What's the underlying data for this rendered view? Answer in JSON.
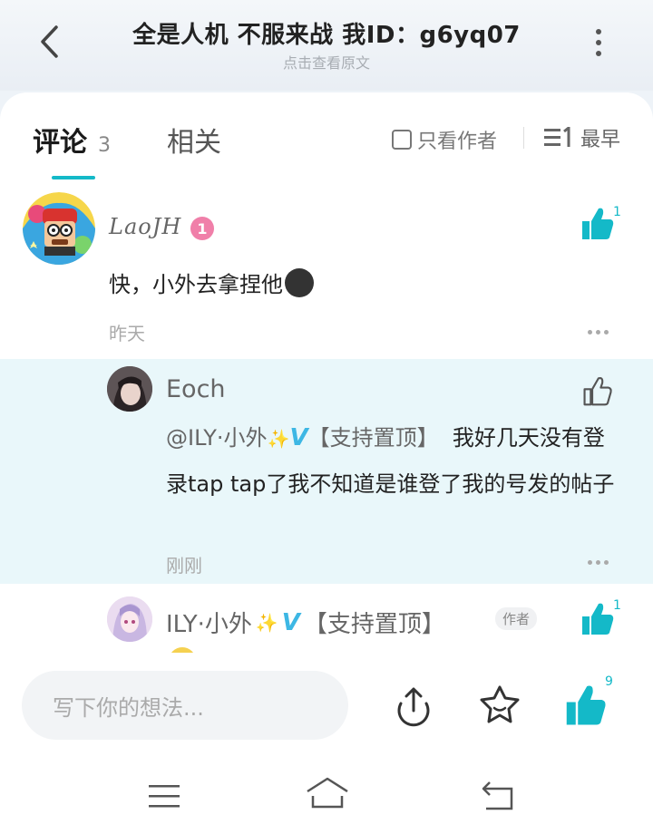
{
  "header": {
    "title": "全是人机 不服来战  我ID：g6yq07",
    "subtitle": "点击查看原文"
  },
  "tabs": {
    "comments_label": "评论",
    "comments_count": "3",
    "related_label": "相关",
    "author_only_label": "只看作者",
    "sort_label": "最早"
  },
  "comments": [
    {
      "username": "LaoJH",
      "level_badge": "1",
      "text": "快，小外去拿捏他",
      "time": "昨天",
      "like_count": "1"
    }
  ],
  "replies": [
    {
      "username": "Eoch",
      "mention": "@ILY·小外",
      "mention_tag": "【支持置顶】",
      "text": "我好几天没有登录tap tap了我不知道是谁登了我的号发的帖子",
      "time": "刚刚"
    },
    {
      "username": "ILY·小外",
      "tag": "【支持置顶】",
      "author_tag": "作者",
      "like_count": "1"
    }
  ],
  "bottom": {
    "input_placeholder": "写下你的想法...",
    "like_count": "9"
  },
  "colors": {
    "accent": "#14b9c8",
    "reply_highlight": "#e9f7fa",
    "verified": "#3db7e4"
  }
}
